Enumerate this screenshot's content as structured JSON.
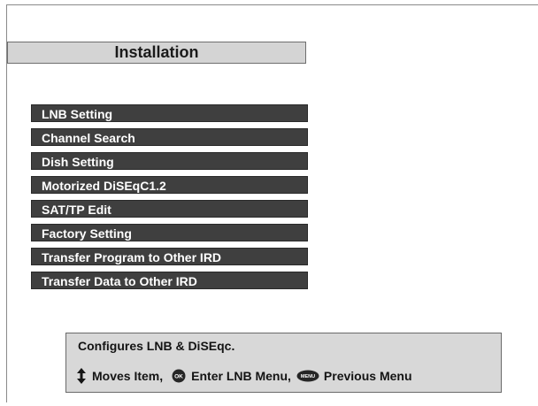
{
  "header": {
    "title": "Installation"
  },
  "menu": {
    "items": [
      {
        "label": "LNB Setting"
      },
      {
        "label": "Channel Search"
      },
      {
        "label": "Dish Setting"
      },
      {
        "label": "Motorized DiSEqC1.2"
      },
      {
        "label": "SAT/TP Edit"
      },
      {
        "label": "Factory Setting"
      },
      {
        "label": "Transfer Program to Other IRD"
      },
      {
        "label": "Transfer Data to Other IRD"
      }
    ]
  },
  "help": {
    "description": "Configures LNB & DiSEqc.",
    "move_hint": "Moves Item,",
    "ok_key_label": "OK",
    "ok_hint": "Enter LNB Menu,",
    "menu_key_label": "MENU",
    "menu_hint": "Previous Menu"
  },
  "colors": {
    "menu_item_bg": "#3f3f3f",
    "title_bg": "#d4d4d4",
    "help_bg": "#d8d8d8"
  },
  "icons": {
    "move": "up-down-arrow-icon",
    "ok": "ok-button-icon",
    "menu": "menu-button-icon"
  }
}
